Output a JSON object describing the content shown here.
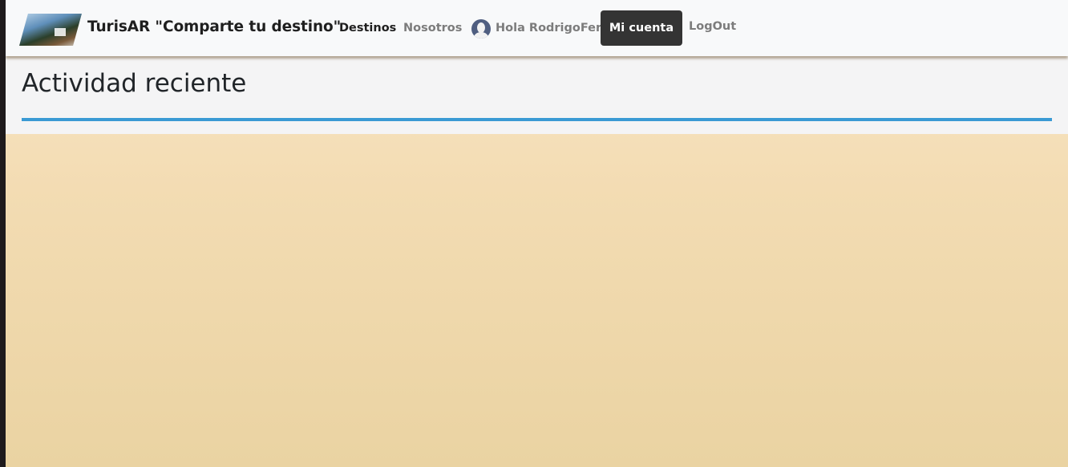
{
  "navbar": {
    "brand_title": "TurisAR \"Comparte tu destino\"",
    "links": {
      "destinos": "Destinos",
      "nosotros": "Nosotros",
      "greeting": "Hola RodrigoFer",
      "mi_cuenta": "Mi cuenta",
      "logout": "LogOut"
    },
    "icons": {
      "brand_logo": "brand-logo-image",
      "avatar": "user-avatar-icon"
    }
  },
  "main": {
    "title": "Actividad reciente"
  },
  "colors": {
    "navbar_bg": "#f8f9fa",
    "button_bg": "#343434",
    "accent_rule": "#3a9ad4",
    "content_gradient_top": "#f9e7c8",
    "content_gradient_bottom": "#ead3a2"
  }
}
